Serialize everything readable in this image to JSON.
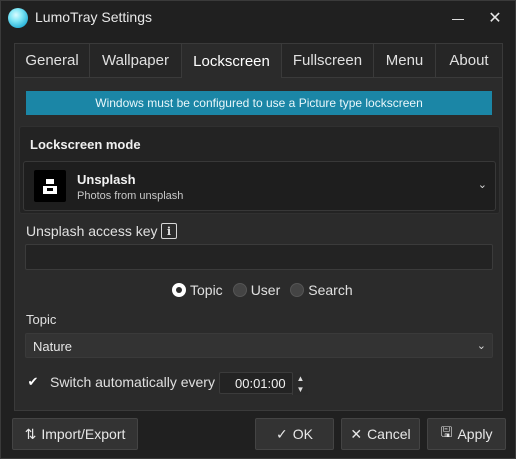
{
  "window": {
    "title": "LumoTray Settings",
    "minimize_icon": "minimize-icon",
    "close_icon": "close-icon",
    "close_glyph": "✕"
  },
  "tabs": [
    {
      "label": "General"
    },
    {
      "label": "Wallpaper"
    },
    {
      "label": "Lockscreen",
      "active": true
    },
    {
      "label": "Fullscreen"
    },
    {
      "label": "Menu"
    },
    {
      "label": "About"
    }
  ],
  "banner": {
    "text": "Windows must be configured to use a Picture type lockscreen",
    "color": "#1b86a6"
  },
  "lockscreen_mode": {
    "heading": "Lockscreen mode",
    "selected_name": "Unsplash",
    "selected_description": "Photos from unsplash",
    "icon": "unsplash-logo-icon",
    "chevron": "⌄"
  },
  "access_key": {
    "label": "Unsplash access key",
    "info_glyph": "i",
    "value": "",
    "placeholder": ""
  },
  "source_options": [
    {
      "label": "Topic",
      "checked": true
    },
    {
      "label": "User",
      "checked": false
    },
    {
      "label": "Search",
      "checked": false
    }
  ],
  "topic": {
    "label": "Topic",
    "value": "Nature",
    "chevron": "⌄"
  },
  "auto_switch": {
    "check_glyph": "✔",
    "checked": true,
    "label": "Switch automatically every",
    "interval": "00:01:00",
    "spin_up": "▲",
    "spin_down": "▼"
  },
  "buttons": {
    "import_export": {
      "label": "Import/Export",
      "icon_glyph": "⇅"
    },
    "ok": {
      "label": "OK",
      "icon_glyph": "✓"
    },
    "cancel": {
      "label": "Cancel",
      "icon_glyph": "✕"
    },
    "apply": {
      "label": "Apply",
      "icon_glyph": "🖫"
    }
  }
}
